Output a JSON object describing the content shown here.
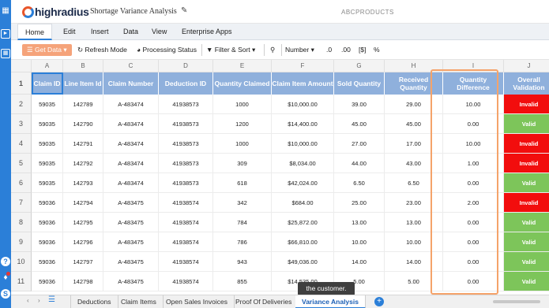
{
  "app": {
    "logo_text": "highradius",
    "doc_title": "Shortage Variance Analysis",
    "brand": "ABCPRODUCTS"
  },
  "ribbon_tabs": [
    "Home",
    "Edit",
    "Insert",
    "Data",
    "View",
    "Enterprise Apps"
  ],
  "toolbar": {
    "get_data": "Get Data",
    "refresh_mode": "Refresh Mode",
    "processing_status": "Processing Status",
    "filter_sort": "Filter & Sort",
    "number": "Number"
  },
  "grid": {
    "column_letters": [
      "A",
      "B",
      "C",
      "D",
      "E",
      "F",
      "G",
      "H",
      "I",
      "J"
    ],
    "headers": [
      "Claim ID",
      "Line Item Id",
      "Claim Number",
      "Deduction ID",
      "Quantity Claimed",
      "Claim Item Amount",
      "Sold Quantity",
      "Received Quantity",
      "Quantity Difference",
      "Overall Validation"
    ],
    "row_numbers": [
      "1",
      "2",
      "3",
      "4",
      "5",
      "6",
      "7",
      "8",
      "9",
      "10",
      "11"
    ],
    "rows": [
      [
        "59035",
        "142789",
        "A-483474",
        "41938573",
        "1000",
        "$10,000.00",
        "39.00",
        "29.00",
        "10.00",
        "Invalid"
      ],
      [
        "59035",
        "142790",
        "A-483474",
        "41938573",
        "1200",
        "$14,400.00",
        "45.00",
        "45.00",
        "0.00",
        "Valid"
      ],
      [
        "59035",
        "142791",
        "A-483474",
        "41938573",
        "1000",
        "$10,000.00",
        "27.00",
        "17.00",
        "10.00",
        "Invalid"
      ],
      [
        "59035",
        "142792",
        "A-483474",
        "41938573",
        "309",
        "$8,034.00",
        "44.00",
        "43.00",
        "1.00",
        "Invalid"
      ],
      [
        "59035",
        "142793",
        "A-483474",
        "41938573",
        "618",
        "$42,024.00",
        "6.50",
        "6.50",
        "0.00",
        "Valid"
      ],
      [
        "59036",
        "142794",
        "A-483475",
        "41938574",
        "342",
        "$684.00",
        "25.00",
        "23.00",
        "2.00",
        "Invalid"
      ],
      [
        "59036",
        "142795",
        "A-483475",
        "41938574",
        "784",
        "$25,872.00",
        "13.00",
        "13.00",
        "0.00",
        "Valid"
      ],
      [
        "59036",
        "142796",
        "A-483475",
        "41938574",
        "786",
        "$66,810.00",
        "10.00",
        "10.00",
        "0.00",
        "Valid"
      ],
      [
        "59036",
        "142797",
        "A-483475",
        "41938574",
        "943",
        "$49,036.00",
        "14.00",
        "14.00",
        "0.00",
        "Valid"
      ],
      [
        "59036",
        "142798",
        "A-483475",
        "41938574",
        "855",
        "$14,535.00",
        "5.00",
        "5.00",
        "0.00",
        "Valid"
      ]
    ]
  },
  "tooltip": "the customer.",
  "sheet_tabs": [
    "Deductions",
    "Claim Items",
    "Open Sales Invoices",
    "Proof Of Deliveries",
    "Variance Analysis"
  ],
  "active_sheet": "Variance Analysis",
  "colors": {
    "accent": "#2b7fd8",
    "header_blue": "#8fb0dc",
    "valid_green": "#7dc55a",
    "invalid_red": "#f20d0d",
    "highlight_orange": "#f5a36a"
  }
}
